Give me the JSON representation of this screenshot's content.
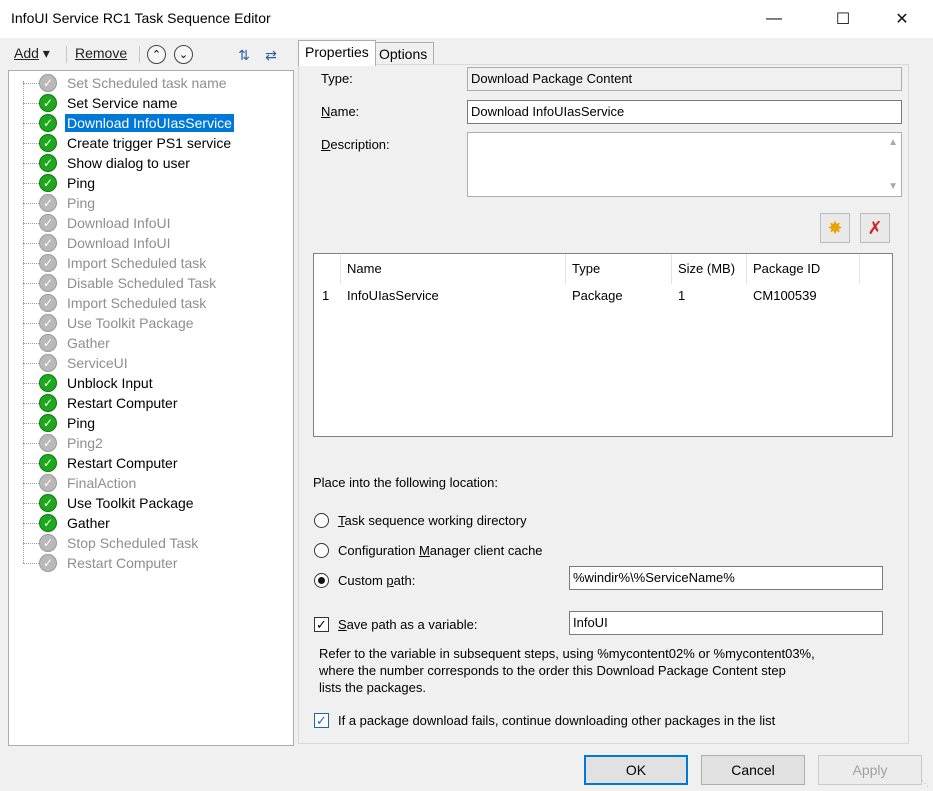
{
  "window": {
    "title": "InfoUI Service RC1 Task Sequence Editor"
  },
  "toolbar": {
    "add_label": "Add",
    "remove_label": "Remove"
  },
  "tree": {
    "items": [
      {
        "label": "Set Scheduled task name",
        "enabled": false
      },
      {
        "label": "Set Service name",
        "enabled": true
      },
      {
        "label": "Download InfoUIasService",
        "enabled": true,
        "selected": true
      },
      {
        "label": "Create trigger PS1 service",
        "enabled": true
      },
      {
        "label": "Show dialog to user",
        "enabled": true
      },
      {
        "label": "Ping",
        "enabled": true
      },
      {
        "label": "Ping",
        "enabled": false
      },
      {
        "label": "Download InfoUI",
        "enabled": false
      },
      {
        "label": "Download InfoUI",
        "enabled": false
      },
      {
        "label": "Import Scheduled task",
        "enabled": false
      },
      {
        "label": "Disable Scheduled Task",
        "enabled": false
      },
      {
        "label": "Import Scheduled task",
        "enabled": false
      },
      {
        "label": "Use Toolkit Package",
        "enabled": false
      },
      {
        "label": "Gather",
        "enabled": false
      },
      {
        "label": "ServiceUI",
        "enabled": false
      },
      {
        "label": "Unblock Input",
        "enabled": true
      },
      {
        "label": "Restart Computer",
        "enabled": true
      },
      {
        "label": "Ping",
        "enabled": true
      },
      {
        "label": "Ping2",
        "enabled": false
      },
      {
        "label": "Restart Computer",
        "enabled": true
      },
      {
        "label": "FinalAction",
        "enabled": false
      },
      {
        "label": "Use Toolkit Package",
        "enabled": true
      },
      {
        "label": "Gather",
        "enabled": true
      },
      {
        "label": "Stop Scheduled Task",
        "enabled": false
      },
      {
        "label": "Restart Computer",
        "enabled": false
      }
    ]
  },
  "tabs": {
    "properties": "Properties",
    "options": "Options"
  },
  "properties": {
    "type_label": "Type:",
    "type_value": "Download Package Content",
    "name_label": "Name:",
    "name_value": "Download InfoUIasService",
    "description_label": "Description:",
    "description_value": "",
    "packages": {
      "columns": [
        "",
        "Name",
        "Type",
        "Size (MB)",
        "Package ID"
      ],
      "rows": [
        {
          "index": "1",
          "name": "InfoUIasService",
          "type": "Package",
          "size": "1",
          "package_id": "CM100539"
        }
      ]
    },
    "location_label": "Place into the following location:",
    "opt_working_dir": "Task sequence working directory",
    "opt_client_cache": "Configuration Manager client cache",
    "opt_custom_path": "Custom path:",
    "selected_location": "custom_path",
    "custom_path_value": "%windir%\\%ServiceName%",
    "save_var_label": "Save path as a variable:",
    "save_var_checked": true,
    "save_var_value": "InfoUI",
    "help_line1": "Refer to the variable in subsequent steps, using %mycontent02% or %mycontent03%,",
    "help_line2": "where the number corresponds to the order this Download Package Content step",
    "help_line3": "lists the packages.",
    "continue_label": "If a package download fails, continue downloading other packages in the list",
    "continue_checked": true
  },
  "buttons": {
    "ok": "OK",
    "cancel": "Cancel",
    "apply": "Apply"
  },
  "icons": [
    "minimize-icon",
    "maximize-icon",
    "close-icon",
    "move-up-icon",
    "move-down-icon",
    "collapse-icon",
    "expand-icon",
    "new-package-icon",
    "delete-package-icon",
    "check-icon"
  ],
  "colors": {
    "selection": "#0078d7",
    "ok_status": "#1ea81e",
    "disabled_status": "#b9b9b9"
  }
}
